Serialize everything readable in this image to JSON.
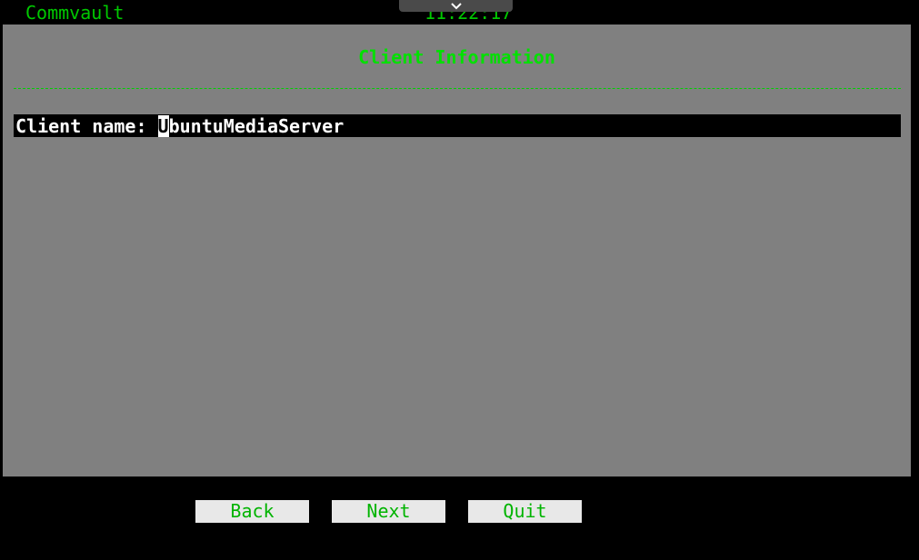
{
  "header": {
    "app_title": "Commvault",
    "clock": "11:22:17"
  },
  "collapse_tab": {
    "icon": "chevron-down-icon"
  },
  "panel": {
    "title": "Client Information",
    "field": {
      "label": "Client name: ",
      "cursor_char": "U",
      "value_rest": "buntuMediaServer"
    }
  },
  "buttons": {
    "back": "Back",
    "next": "Next",
    "quit": "Quit"
  },
  "colors": {
    "terminal_green": "#00c800",
    "panel_background": "#808080",
    "button_background": "#e8e8e8"
  }
}
